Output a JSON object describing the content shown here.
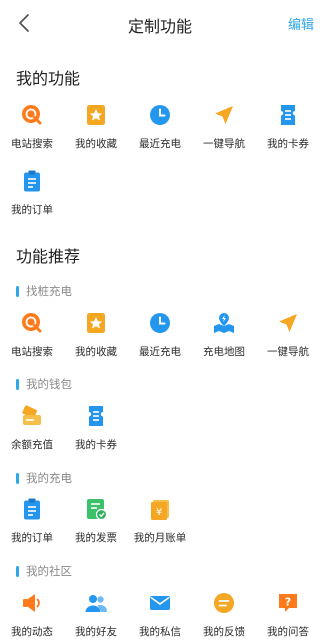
{
  "header": {
    "title": "定制功能",
    "edit_label": "编辑"
  },
  "my_functions": {
    "title": "我的功能",
    "rows": [
      [
        {
          "name": "station-search",
          "label": "电站搜索",
          "icon": "search-icon"
        },
        {
          "name": "favorites",
          "label": "我的收藏",
          "icon": "star-icon"
        },
        {
          "name": "recent-charge",
          "label": "最近充电",
          "icon": "clock-icon"
        },
        {
          "name": "one-tap-nav",
          "label": "一键导航",
          "icon": "navigate-icon"
        },
        {
          "name": "my-coupons",
          "label": "我的卡券",
          "icon": "ticket-icon"
        }
      ],
      [
        {
          "name": "my-orders",
          "label": "我的订单",
          "icon": "clipboard-icon"
        }
      ]
    ]
  },
  "recommend": {
    "title": "功能推荐",
    "groups": [
      {
        "title": "找桩充电",
        "items": [
          {
            "name": "station-search",
            "label": "电站搜索",
            "icon": "search-icon"
          },
          {
            "name": "favorites",
            "label": "我的收藏",
            "icon": "star-icon"
          },
          {
            "name": "recent-charge",
            "label": "最近充电",
            "icon": "clock-icon"
          },
          {
            "name": "charging-map",
            "label": "充电地图",
            "icon": "map-icon"
          },
          {
            "name": "one-tap-nav",
            "label": "一键导航",
            "icon": "navigate-icon"
          }
        ]
      },
      {
        "title": "我的钱包",
        "items": [
          {
            "name": "balance-topup",
            "label": "余额充值",
            "icon": "wallet-icon"
          },
          {
            "name": "my-coupons",
            "label": "我的卡券",
            "icon": "ticket-icon"
          }
        ]
      },
      {
        "title": "我的充电",
        "items": [
          {
            "name": "my-orders",
            "label": "我的订单",
            "icon": "clipboard-icon"
          },
          {
            "name": "my-invoices",
            "label": "我的发票",
            "icon": "invoice-icon"
          },
          {
            "name": "monthly-bill",
            "label": "我的月账单",
            "icon": "bill-icon"
          }
        ]
      },
      {
        "title": "我的社区",
        "items": [
          {
            "name": "my-posts",
            "label": "我的动态",
            "icon": "speaker-icon"
          },
          {
            "name": "my-friends",
            "label": "我的好友",
            "icon": "friends-icon"
          },
          {
            "name": "my-messages",
            "label": "我的私信",
            "icon": "mail-icon"
          },
          {
            "name": "my-feedback",
            "label": "我的反馈",
            "icon": "feedback-icon"
          },
          {
            "name": "my-questions",
            "label": "我的问答",
            "icon": "question-icon"
          }
        ]
      }
    ]
  },
  "colors": {
    "accent": "#2fa8e8",
    "orange": "#ff7a1a",
    "amber": "#f5a623",
    "blue": "#2496ee",
    "green": "#3cc16b"
  }
}
